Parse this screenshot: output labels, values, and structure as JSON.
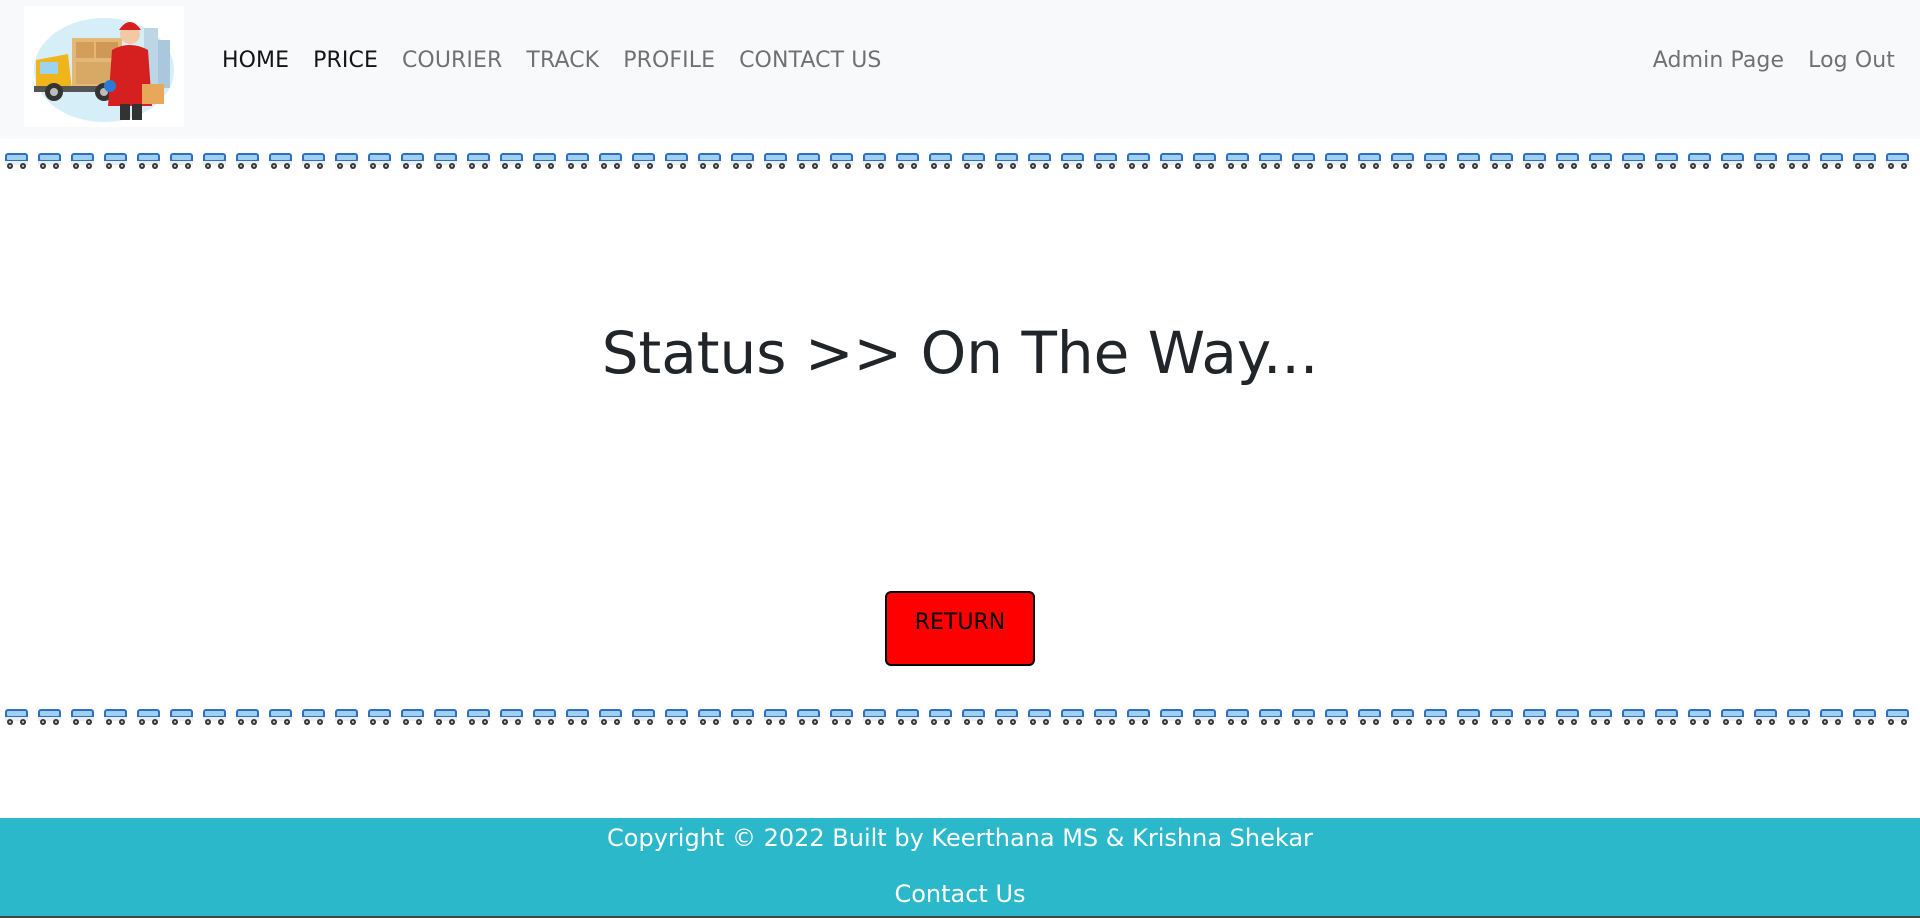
{
  "nav": {
    "items": [
      {
        "label": "HOME"
      },
      {
        "label": "PRICE"
      },
      {
        "label": "COURIER"
      },
      {
        "label": "TRACK"
      },
      {
        "label": "PROFILE"
      },
      {
        "label": "CONTACT US"
      }
    ],
    "right": {
      "admin": "Admin Page",
      "logout": "Log Out"
    }
  },
  "main": {
    "status_text": "Status >> On The Way...",
    "return_label": "RETURN"
  },
  "footer": {
    "copyright": "Copyright © 2022 Built by Keerthana MS & Krishna Shekar",
    "contact": "Contact Us"
  },
  "colors": {
    "navbar_bg": "#f8f9fa",
    "return_button": "#ff0000",
    "footer_bg": "#2ab8ca",
    "bus_blue": "#4a90d9"
  },
  "icons": {
    "logo": "delivery-man-truck-logo",
    "bus": "bus-icon"
  }
}
